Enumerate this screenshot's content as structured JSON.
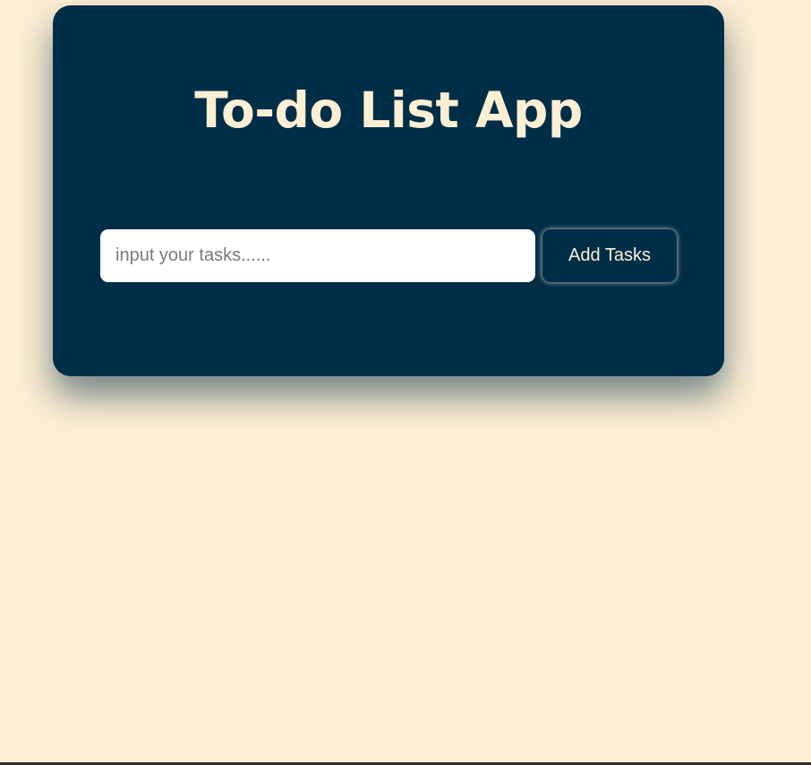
{
  "app": {
    "title": "To-do List App"
  },
  "task_form": {
    "input_value": "",
    "input_placeholder": "input your tasks......",
    "add_button_label": "Add Tasks"
  },
  "colors": {
    "background": "#FDEFD4",
    "card": "#002E47",
    "accent_text": "#FDEFD4",
    "input_background": "#FFFFFF"
  }
}
